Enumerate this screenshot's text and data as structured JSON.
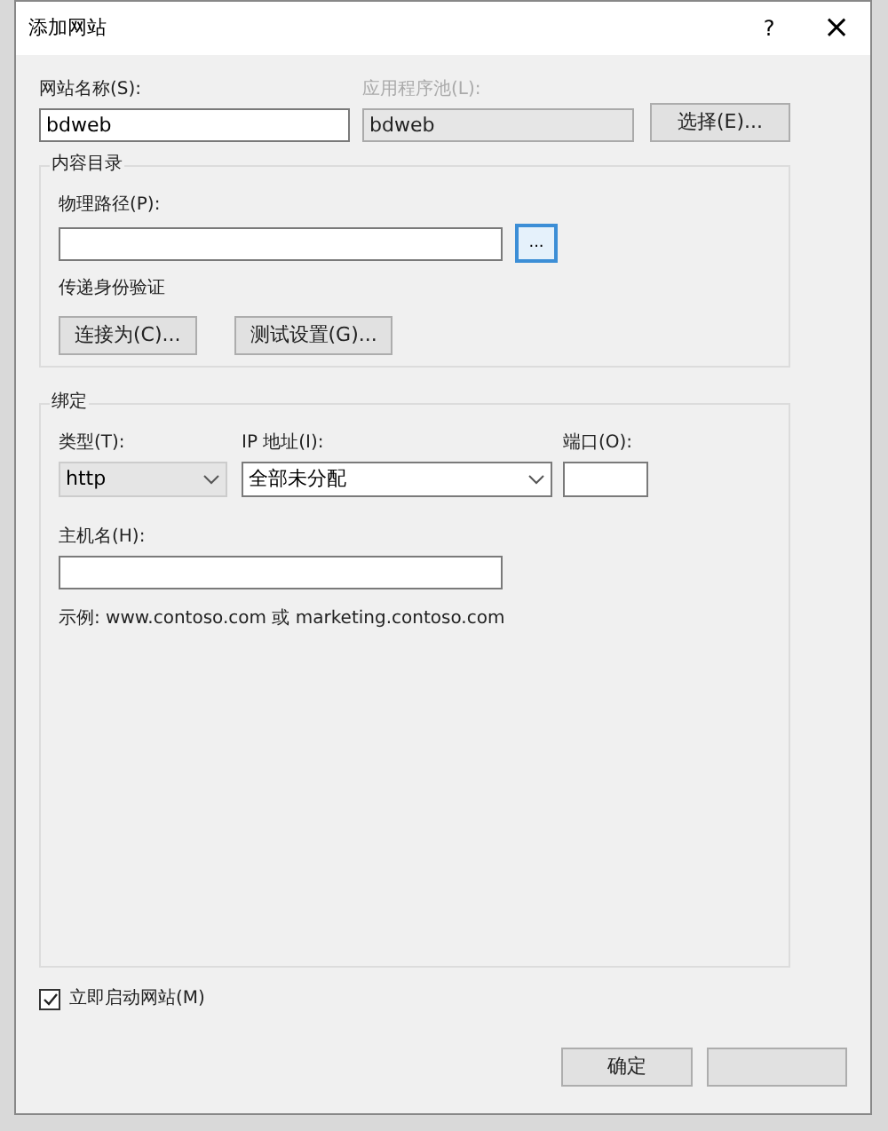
{
  "window": {
    "title": "添加网站",
    "help": "?",
    "close": "×"
  },
  "site_name": {
    "label": "网站名称(S):",
    "value": "bdweb"
  },
  "app_pool": {
    "label": "应用程序池(L):",
    "value": "bdweb",
    "disabled": true,
    "button": "选择(E)..."
  },
  "content_directory": {
    "title": "内容目录",
    "path_label": "物理路径(P):",
    "browse_button": "...",
    "auth_label": "传递身份验证",
    "buttons": [
      "连接为(C)...",
      "测试设置(G)..."
    ]
  },
  "binding": {
    "title": "绑定",
    "type_label": "类型(T):",
    "type_value": "http",
    "ip_label": "IP 地址(I):",
    "ip_value": "全部未分配",
    "port_label": "端口(O):",
    "host_label": "主机名(H):",
    "example": "示例: www.contoso.com 或 marketing.contoso.com"
  },
  "start_immediately": {
    "label": "立即启动网站(M)",
    "checked": true
  },
  "buttons": [
    "确定"
  ]
}
